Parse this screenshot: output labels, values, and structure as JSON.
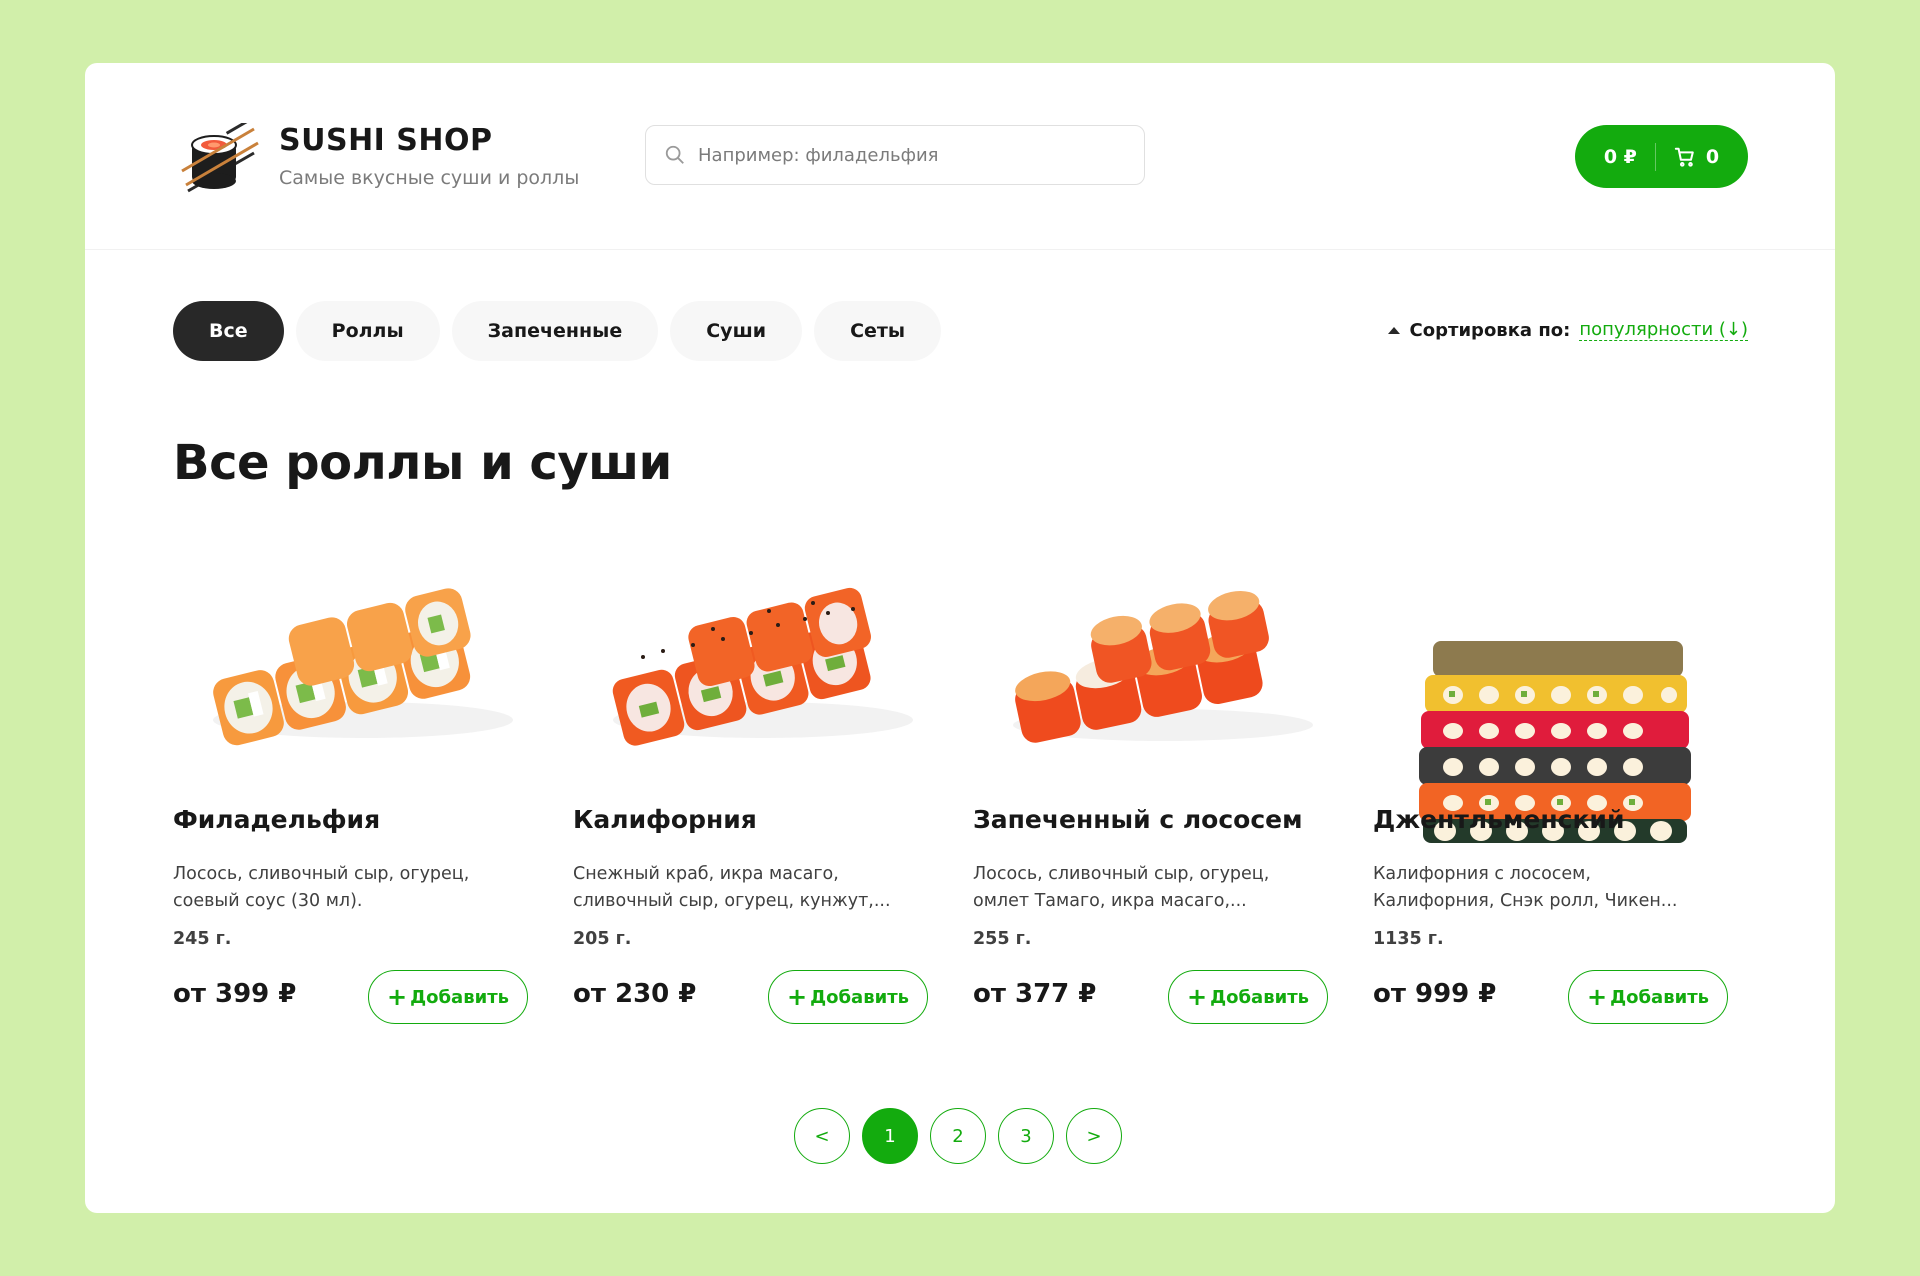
{
  "header": {
    "brand_title": "SUSHI SHOP",
    "brand_subtitle": "Самые вкусные суши и роллы",
    "search_placeholder": "Например: филадельфия",
    "cart_total": "0 ₽",
    "cart_count": "0"
  },
  "categories": [
    {
      "label": "Все",
      "active": true
    },
    {
      "label": "Роллы",
      "active": false
    },
    {
      "label": "Запеченные",
      "active": false
    },
    {
      "label": "Суши",
      "active": false
    },
    {
      "label": "Сеты",
      "active": false
    }
  ],
  "sort": {
    "label": "Сортировка по:",
    "value": "популярности (↓)"
  },
  "section_title": "Все роллы и суши",
  "products": [
    {
      "name": "Филадельфия",
      "description": "Лосось, сливочный сыр, огурец, соевый соус (30 мл).",
      "weight": "245 г.",
      "price": "от 399 ₽",
      "add_label": "Добавить"
    },
    {
      "name": "Калифорния",
      "description": "Снежный краб, икра масаго, сливочный сыр, огурец, кунжут,...",
      "weight": "205 г.",
      "price": "от 230 ₽",
      "add_label": "Добавить"
    },
    {
      "name": "Запеченный с лососем",
      "description": "Лосось, сливочный сыр, огурец, омлет Тамаго, икра масаго,...",
      "weight": "255 г.",
      "price": "от 377 ₽",
      "add_label": "Добавить"
    },
    {
      "name": "Джентльменский",
      "description": "Калифорния с лососем, Калифорния, Снэк ролл, Чикен...",
      "weight": "1135 г.",
      "price": "от 999 ₽",
      "add_label": "Добавить"
    }
  ],
  "pagination": {
    "prev": "<",
    "pages": [
      "1",
      "2",
      "3"
    ],
    "active_page": "1",
    "next": ">"
  },
  "colors": {
    "accent": "#13ab0e",
    "page_bg": "#d1efaa",
    "dark": "#282828"
  }
}
